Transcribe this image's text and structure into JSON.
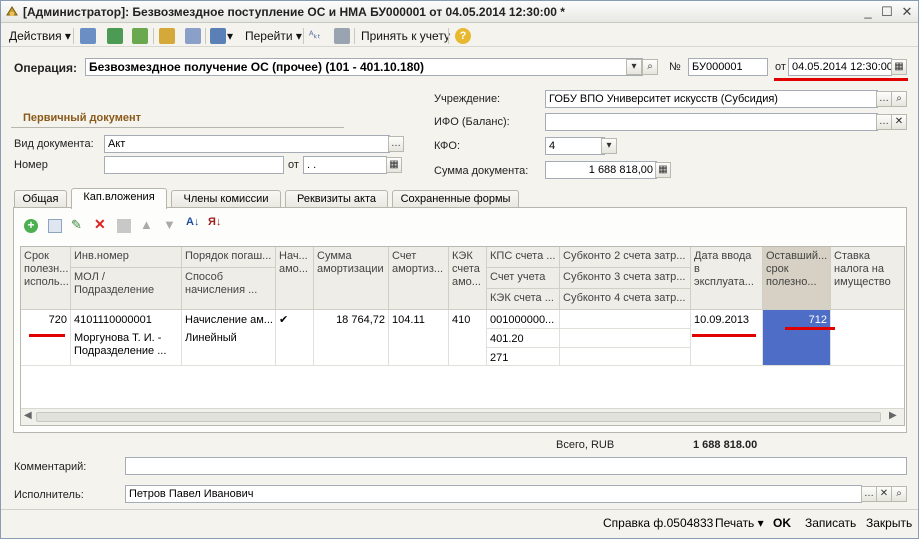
{
  "window": {
    "title": "[Администратор]: Безвозмездное поступление ОС и НМА БУ000001 от 04.05.2014 12:30:00 *"
  },
  "toolbar": {
    "actions": "Действия",
    "goto": "Перейти",
    "accept": "Принять к учету"
  },
  "header": {
    "operation_label": "Операция:",
    "operation_value": "Безвозмездное получение ОС (прочее) (101 - 401.10.180)",
    "number_label": "№",
    "number_value": "БУ000001",
    "date_from_label": "от",
    "date_value": "04.05.2014 12:30:00",
    "institution_label": "Учреждение:",
    "institution_value": "ГОБУ ВПО Университет искусств (Субсидия)",
    "ifo_label": "ИФО (Баланс):",
    "ifo_value": "",
    "kfo_label": "КФО:",
    "kfo_value": "4",
    "sum_label": "Сумма документа:",
    "sum_value": "1 688 818,00"
  },
  "primary_doc": {
    "section_title": "Первичный документ",
    "doc_type_label": "Вид документа:",
    "doc_type_value": "Акт",
    "number_label": "Номер",
    "number_value": "",
    "from_label": "от",
    "date_value": " .  ."
  },
  "tabs": [
    "Общая",
    "Кап.вложения",
    "Члены комиссии",
    "Реквизиты акта",
    "Сохраненные формы"
  ],
  "grid": {
    "headers": {
      "c1": "Срок полезн... исполь...",
      "c2a": "Инв.номер",
      "c2b": "МОЛ / Подразделение",
      "c3a": "Порядок погаш...",
      "c3b": "Способ начисления ...",
      "c4": "Нач... амо...",
      "c5": "Сумма амортизации",
      "c6": "Счет амортиз...",
      "c7": "КЭК счета амо...",
      "c8a": "КПС счета ...",
      "c8b": "Счет учета ...",
      "c8c": "КЭК счета ...",
      "c9a": "Субконто 2 счета затр...",
      "c9b": "Субконто 3 счета затр...",
      "c9c": "Субконто 4 счета затр...",
      "c10": "Дата ввода в эксплуата...",
      "c11": "Оставший... срок полезно...",
      "c12": "Ставка налога на имущество"
    },
    "row": {
      "useful_life": "720",
      "inv_number": "4101110000001",
      "mol": "Моргунова Т. И. - Подразделение ...",
      "order_a": "Начисление ам...",
      "order_b": "Линейный",
      "accrue": "✔",
      "amort_sum": "18 764,72",
      "amort_account": "104.11",
      "kek_amort": "410",
      "kps": "001000000...",
      "account": "401.20",
      "kek": "271",
      "commission_date": "10.09.2013",
      "remaining_life": "712"
    }
  },
  "totals": {
    "label": "Всего, RUB",
    "value": "1 688 818.00"
  },
  "footer": {
    "comment_label": "Комментарий:",
    "comment_value": "",
    "executor_label": "Исполнитель:",
    "executor_value": "Петров Павел Иванович"
  },
  "statusbar": {
    "help": "Справка ф.0504833",
    "print": "Печать",
    "ok": "OK",
    "save": "Записать",
    "close": "Закрыть"
  },
  "colors": {
    "highlight_cell": "#4e6dc6",
    "annotation_red": "#e00000",
    "section_title": "#8a5a1a"
  }
}
